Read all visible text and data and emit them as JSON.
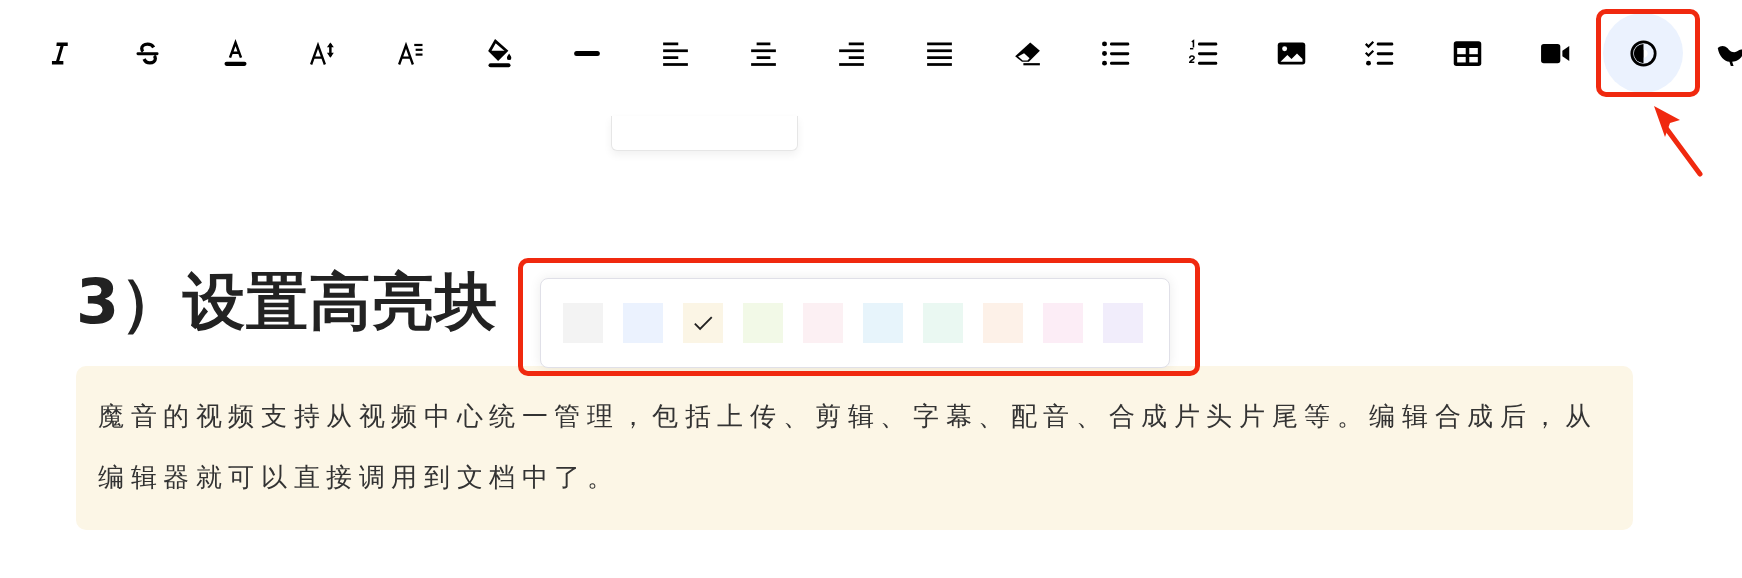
{
  "toolbar": {
    "buttons": [
      {
        "kind": "italic",
        "selected": false
      },
      {
        "kind": "strikethrough",
        "selected": false
      },
      {
        "kind": "font-color",
        "selected": false
      },
      {
        "kind": "line-height",
        "selected": false
      },
      {
        "kind": "paragraph-spacing",
        "selected": false
      },
      {
        "kind": "fill-color",
        "selected": false
      },
      {
        "kind": "divider",
        "selected": false
      },
      {
        "kind": "align-left",
        "selected": false
      },
      {
        "kind": "align-center",
        "selected": false
      },
      {
        "kind": "align-right",
        "selected": false
      },
      {
        "kind": "justify",
        "selected": false
      },
      {
        "kind": "eraser",
        "selected": false
      },
      {
        "kind": "bullet-list",
        "selected": false
      },
      {
        "kind": "numbered-list",
        "selected": false
      },
      {
        "kind": "image",
        "selected": false
      },
      {
        "kind": "checklist",
        "selected": false
      },
      {
        "kind": "table",
        "selected": false
      },
      {
        "kind": "video",
        "selected": false
      },
      {
        "kind": "highlight",
        "selected": true
      },
      {
        "kind": "bird",
        "selected": false
      }
    ]
  },
  "heading": "3）设置高亮块",
  "highlight_picker": {
    "swatches": [
      {
        "color": "#f3f3f3",
        "selected": false
      },
      {
        "color": "#ebf2fe",
        "selected": false
      },
      {
        "color": "#fbf5e5",
        "selected": true
      },
      {
        "color": "#f2f9e7",
        "selected": false
      },
      {
        "color": "#fcf0f3",
        "selected": false
      },
      {
        "color": "#e7f4fb",
        "selected": false
      },
      {
        "color": "#eaf8f2",
        "selected": false
      },
      {
        "color": "#fdf1e8",
        "selected": false
      },
      {
        "color": "#fcedf6",
        "selected": false
      },
      {
        "color": "#f1edfb",
        "selected": false
      }
    ]
  },
  "highlight_block": {
    "color": "#fcf6e6",
    "text": "魔音的视频支持从视频中心统一管理，包括上传、剪辑、字幕、配音、合成片头片尾等。编辑合成后，从编辑器就可以直接调用到文档中了。"
  }
}
